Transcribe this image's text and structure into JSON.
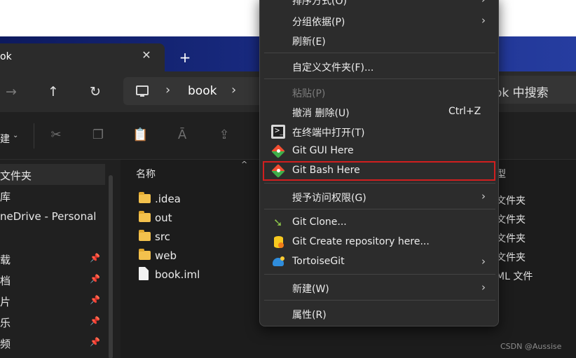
{
  "tab": {
    "title": "ok",
    "close_glyph": "✕",
    "new_glyph": "+"
  },
  "nav": {
    "forward_glyph": "→",
    "up_glyph": "↑",
    "refresh_glyph": "↻"
  },
  "address": {
    "chevron": "›",
    "folder": "book",
    "search_text": "ok 中搜索"
  },
  "toolbar": {
    "new_label": "建",
    "new_caret": "⌄"
  },
  "sidebar": {
    "items": [
      {
        "label": "文件夹",
        "pinned": false,
        "selected": true
      },
      {
        "label": "库",
        "pinned": false
      },
      {
        "label": "neDrive - Personal",
        "pinned": false
      },
      {
        "label": "载",
        "pinned": true
      },
      {
        "label": "档",
        "pinned": true
      },
      {
        "label": "片",
        "pinned": true
      },
      {
        "label": "乐",
        "pinned": true
      },
      {
        "label": "频",
        "pinned": true
      }
    ],
    "pin_glyph": "📌"
  },
  "files": {
    "header_name": "名称",
    "header_type": "型",
    "sort_glyph": "^",
    "rows": [
      {
        "name": ".idea",
        "kind": "folder",
        "type": "文件夹"
      },
      {
        "name": "out",
        "kind": "folder",
        "type": "文件夹"
      },
      {
        "name": "src",
        "kind": "folder",
        "type": "文件夹"
      },
      {
        "name": "web",
        "kind": "folder",
        "type": "文件夹"
      },
      {
        "name": "book.iml",
        "kind": "file",
        "type": "ML 文件"
      }
    ]
  },
  "context_menu": {
    "items": [
      {
        "label": "排序方式(O)",
        "submenu": true
      },
      {
        "label": "分组依据(P)",
        "submenu": true
      },
      {
        "label": "刷新(E)"
      },
      {
        "label": "自定义文件夹(F)..."
      },
      {
        "label": "粘贴(P)",
        "disabled": true
      },
      {
        "label": "撤消 删除(U)",
        "shortcut": "Ctrl+Z"
      },
      {
        "label": "在终端中打开(T)",
        "icon": "terminal-icon"
      },
      {
        "label": "Git GUI Here",
        "icon": "git-gui-icon"
      },
      {
        "label": "Git Bash Here",
        "icon": "git-bash-icon",
        "highlighted": true
      },
      {
        "label": "授予访问权限(G)",
        "submenu": true
      },
      {
        "label": "Git Clone...",
        "icon": "git-clone-icon"
      },
      {
        "label": "Git Create repository here...",
        "icon": "git-create-repo-icon"
      },
      {
        "label": "TortoiseGit",
        "icon": "tortoisegit-icon",
        "submenu": true
      },
      {
        "label": "新建(W)",
        "submenu": true
      },
      {
        "label": "属性(R)"
      }
    ],
    "submenu_glyph": "›",
    "terminal_prompt": ">_"
  },
  "watermark": "CSDN @Aussise"
}
